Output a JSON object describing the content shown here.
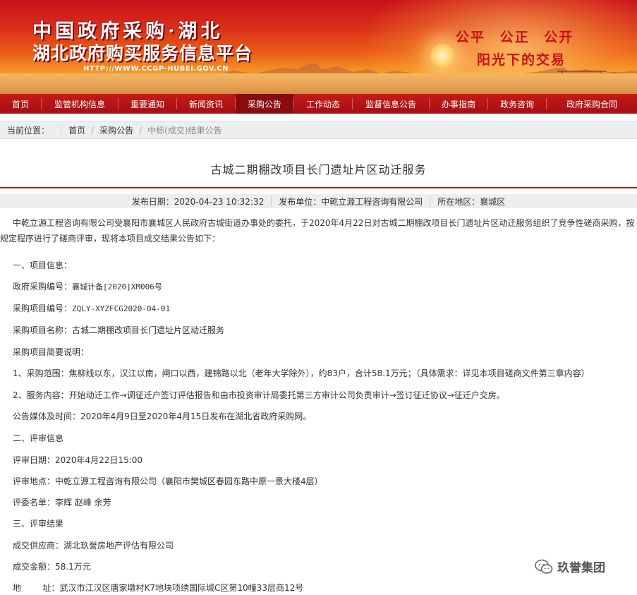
{
  "banner": {
    "title_line1": "中国政府采购·湖北",
    "title_line2": "湖北政府购买服务信息平台",
    "url": "HTTP://WWW.CCGP-HUBEI.GOV.CN",
    "slogan_line1": "公平  公正  公开",
    "slogan_line2": "阳光下的交易",
    "colors": {
      "primary_red": "#c8101a",
      "orange": "#ea5a14"
    }
  },
  "nav": {
    "items": [
      {
        "label": "首页"
      },
      {
        "label": "监管机构信息"
      },
      {
        "label": "重要通知"
      },
      {
        "label": "新闻资讯"
      },
      {
        "label": "采购公告",
        "active": true
      },
      {
        "label": "工作动态"
      },
      {
        "label": "监督信息公告"
      },
      {
        "label": "办事指南"
      },
      {
        "label": "政务咨询"
      },
      {
        "label": "政府采购合同"
      }
    ]
  },
  "breadcrumb": {
    "label": "当前位置：",
    "items": [
      "首页",
      "采购公告"
    ],
    "current": "中标(成交)结果公告"
  },
  "article": {
    "title": "古城二期棚改项目长门遗址片区动迁服务",
    "meta": {
      "date": "发布日期：2020-04-23 10:32:32",
      "publisher": "发布单位：中乾立源工程咨询有限公司",
      "region": "所在地区：襄城区"
    },
    "intro": "中乾立源工程咨询有限公司受襄阳市襄城区人民政府古城街道办事处的委托，于2020年4月22日对古城二期棚改项目长门遗址片区动迁服务组织了竞争性磋商采购，按规定程序进行了磋商评审，现将本项目成交结果公告如下：",
    "section1": "一、项目信息：",
    "proc_no_label": "政府采购编号：",
    "proc_no": "襄城计备[2020]XM006号",
    "proj_no_label": "采购项目编号：",
    "proj_no": "ZQLY-XYZFCG2020-04-01",
    "proj_name": "采购项目名称：古城二期棚改项目长门遗址片区动迁服务",
    "brief": "采购项目简要说明：",
    "scope": "1、采购范围：焦柳线以东，汉江以南，闸口以西，建锦路以北（老年大学除外），约83户，合计58.1万元；（具体需求：详见本项目磋商文件第三章内容）",
    "service": "2、服务内容：开始动迁工作→调征迁户签订评估报告和由市投资审计局委托第三方审计公司负责审计→签订征迁协议→征迁户交房。",
    "media": "公告媒体及时间：2020年4月9日至2020年4月15日发布在湖北省政府采购网。",
    "section2": "二、评审信息",
    "review_date": "评审日期：2020年4月22日15:00",
    "review_place": "评审地点：中乾立源工程咨询有限公司（襄阳市樊城区春园东路中原一景大楼4层）",
    "committee": "评委名单：李辉 赵峰 余芳",
    "section3": "三、评审结果",
    "supplier": "成交供应商：湖北玖誉房地产评估有限公司",
    "amount": "成交金额：58.1万元",
    "address_label": "地        址：",
    "address": "武汉市江汉区唐家墩村K7地块项绣国际城C区第10幢33层商12号"
  },
  "watermark": {
    "text": "玖誉集团",
    "icon": "wechat-icon"
  }
}
